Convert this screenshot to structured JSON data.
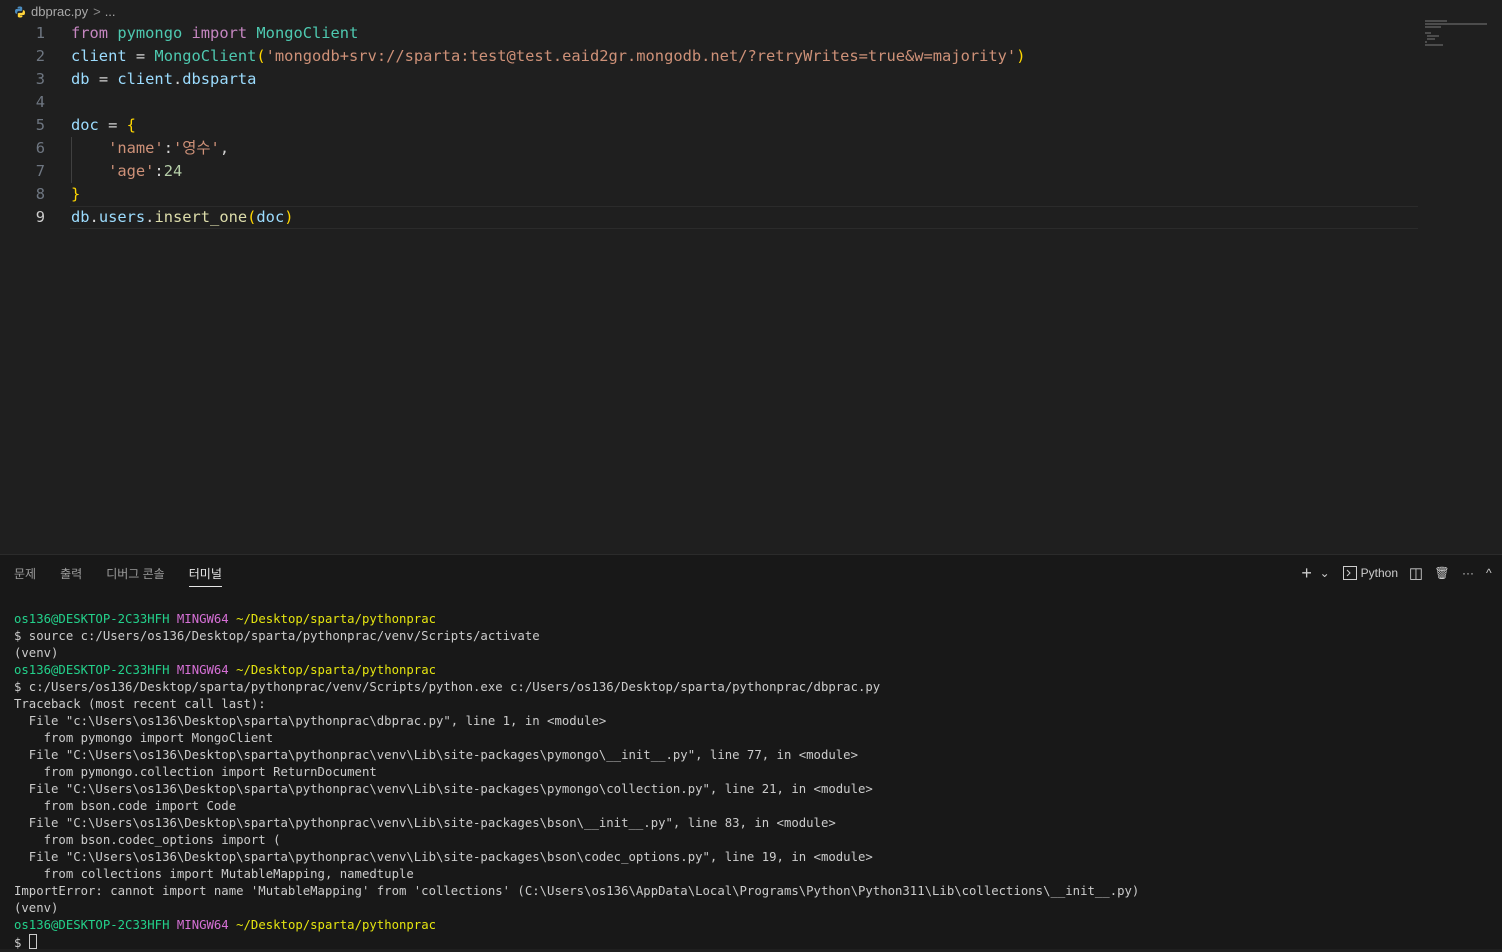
{
  "breadcrumb": {
    "file": "dbprac.py",
    "separator": ">",
    "more": "..."
  },
  "editor": {
    "active_line": 9,
    "lines": [
      {
        "n": "1",
        "guide": false,
        "tokens": [
          {
            "t": "from",
            "c": "kw"
          },
          {
            "t": " ",
            "c": "op"
          },
          {
            "t": "pymongo",
            "c": "mod"
          },
          {
            "t": " ",
            "c": "op"
          },
          {
            "t": "import",
            "c": "kw"
          },
          {
            "t": " ",
            "c": "op"
          },
          {
            "t": "MongoClient",
            "c": "mod"
          }
        ]
      },
      {
        "n": "2",
        "guide": false,
        "tokens": [
          {
            "t": "client",
            "c": "var"
          },
          {
            "t": " = ",
            "c": "op"
          },
          {
            "t": "MongoClient",
            "c": "mod"
          },
          {
            "t": "(",
            "c": "p1"
          },
          {
            "t": "'mongodb+srv://sparta:test@test.eaid2gr.mongodb.net/?retryWrites=true&w=majority'",
            "c": "str"
          },
          {
            "t": ")",
            "c": "p1"
          }
        ]
      },
      {
        "n": "3",
        "guide": false,
        "tokens": [
          {
            "t": "db",
            "c": "var"
          },
          {
            "t": " = ",
            "c": "op"
          },
          {
            "t": "client",
            "c": "var"
          },
          {
            "t": ".",
            "c": "op"
          },
          {
            "t": "dbsparta",
            "c": "var"
          }
        ]
      },
      {
        "n": "4",
        "guide": false,
        "tokens": []
      },
      {
        "n": "5",
        "guide": false,
        "tokens": [
          {
            "t": "doc",
            "c": "var"
          },
          {
            "t": " = ",
            "c": "op"
          },
          {
            "t": "{",
            "c": "p1"
          }
        ]
      },
      {
        "n": "6",
        "guide": true,
        "tokens": [
          {
            "t": "    ",
            "c": "op"
          },
          {
            "t": "'name'",
            "c": "str"
          },
          {
            "t": ":",
            "c": "op"
          },
          {
            "t": "'영수'",
            "c": "str"
          },
          {
            "t": ",",
            "c": "op"
          }
        ]
      },
      {
        "n": "7",
        "guide": true,
        "tokens": [
          {
            "t": "    ",
            "c": "op"
          },
          {
            "t": "'age'",
            "c": "str"
          },
          {
            "t": ":",
            "c": "op"
          },
          {
            "t": "24",
            "c": "num"
          }
        ]
      },
      {
        "n": "8",
        "guide": false,
        "tokens": [
          {
            "t": "}",
            "c": "p1"
          }
        ]
      },
      {
        "n": "9",
        "guide": false,
        "tokens": [
          {
            "t": "db",
            "c": "var"
          },
          {
            "t": ".",
            "c": "op"
          },
          {
            "t": "users",
            "c": "var"
          },
          {
            "t": ".",
            "c": "op"
          },
          {
            "t": "insert_one",
            "c": "fn"
          },
          {
            "t": "(",
            "c": "p1"
          },
          {
            "t": "doc",
            "c": "var"
          },
          {
            "t": ")",
            "c": "p1"
          }
        ]
      }
    ]
  },
  "panel": {
    "tabs": [
      {
        "label": "문제",
        "active": false
      },
      {
        "label": "출력",
        "active": false
      },
      {
        "label": "디버그 콘솔",
        "active": false
      },
      {
        "label": "터미널",
        "active": true
      }
    ],
    "actions": {
      "new_terminal": "+",
      "dropdown": "⌄",
      "terminal_name": "Python",
      "split": "◫",
      "trash": "🗑",
      "more": "···",
      "maximize": "^"
    }
  },
  "terminal": {
    "lines": [
      {
        "segments": [
          {
            "t": "os136@DESKTOP-2C33HFH",
            "c": "user"
          },
          {
            "t": " ",
            "c": ""
          },
          {
            "t": "MINGW64",
            "c": "sys"
          },
          {
            "t": " ",
            "c": ""
          },
          {
            "t": "~/Desktop/sparta/pythonprac",
            "c": "path"
          }
        ]
      },
      {
        "segments": [
          {
            "t": "$ source c:/Users/os136/Desktop/sparta/pythonprac/venv/Scripts/activate",
            "c": ""
          }
        ]
      },
      {
        "segments": [
          {
            "t": "(venv)",
            "c": ""
          }
        ]
      },
      {
        "segments": [
          {
            "t": "os136@DESKTOP-2C33HFH",
            "c": "user"
          },
          {
            "t": " ",
            "c": ""
          },
          {
            "t": "MINGW64",
            "c": "sys"
          },
          {
            "t": " ",
            "c": ""
          },
          {
            "t": "~/Desktop/sparta/pythonprac",
            "c": "path"
          }
        ]
      },
      {
        "segments": [
          {
            "t": "$ c:/Users/os136/Desktop/sparta/pythonprac/venv/Scripts/python.exe c:/Users/os136/Desktop/sparta/pythonprac/dbprac.py",
            "c": ""
          }
        ]
      },
      {
        "segments": [
          {
            "t": "Traceback (most recent call last):",
            "c": ""
          }
        ]
      },
      {
        "segments": [
          {
            "t": "  File \"c:\\Users\\os136\\Desktop\\sparta\\pythonprac\\dbprac.py\", line 1, in <module>",
            "c": ""
          }
        ]
      },
      {
        "segments": [
          {
            "t": "    from pymongo import MongoClient",
            "c": ""
          }
        ]
      },
      {
        "segments": [
          {
            "t": "  File \"C:\\Users\\os136\\Desktop\\sparta\\pythonprac\\venv\\Lib\\site-packages\\pymongo\\__init__.py\", line 77, in <module>",
            "c": ""
          }
        ]
      },
      {
        "segments": [
          {
            "t": "    from pymongo.collection import ReturnDocument",
            "c": ""
          }
        ]
      },
      {
        "segments": [
          {
            "t": "  File \"C:\\Users\\os136\\Desktop\\sparta\\pythonprac\\venv\\Lib\\site-packages\\pymongo\\collection.py\", line 21, in <module>",
            "c": ""
          }
        ]
      },
      {
        "segments": [
          {
            "t": "    from bson.code import Code",
            "c": ""
          }
        ]
      },
      {
        "segments": [
          {
            "t": "  File \"C:\\Users\\os136\\Desktop\\sparta\\pythonprac\\venv\\Lib\\site-packages\\bson\\__init__.py\", line 83, in <module>",
            "c": ""
          }
        ]
      },
      {
        "segments": [
          {
            "t": "    from bson.codec_options import (",
            "c": ""
          }
        ]
      },
      {
        "segments": [
          {
            "t": "  File \"C:\\Users\\os136\\Desktop\\sparta\\pythonprac\\venv\\Lib\\site-packages\\bson\\codec_options.py\", line 19, in <module>",
            "c": ""
          }
        ]
      },
      {
        "segments": [
          {
            "t": "    from collections import MutableMapping, namedtuple",
            "c": ""
          }
        ]
      },
      {
        "segments": [
          {
            "t": "ImportError: cannot import name 'MutableMapping' from 'collections' (C:\\Users\\os136\\AppData\\Local\\Programs\\Python\\Python311\\Lib\\collections\\__init__.py)",
            "c": ""
          }
        ]
      },
      {
        "segments": [
          {
            "t": "(venv)",
            "c": ""
          }
        ]
      },
      {
        "segments": [
          {
            "t": "os136@DESKTOP-2C33HFH",
            "c": "user"
          },
          {
            "t": " ",
            "c": ""
          },
          {
            "t": "MINGW64",
            "c": "sys"
          },
          {
            "t": " ",
            "c": ""
          },
          {
            "t": "~/Desktop/sparta/pythonprac",
            "c": "path"
          }
        ]
      }
    ],
    "prompt": "$ "
  },
  "colors": {
    "background": "#1f1f1f",
    "panel_background": "#181818",
    "terminal_user": "#23d18b",
    "terminal_system": "#d670d6",
    "terminal_path": "#e5e510"
  }
}
